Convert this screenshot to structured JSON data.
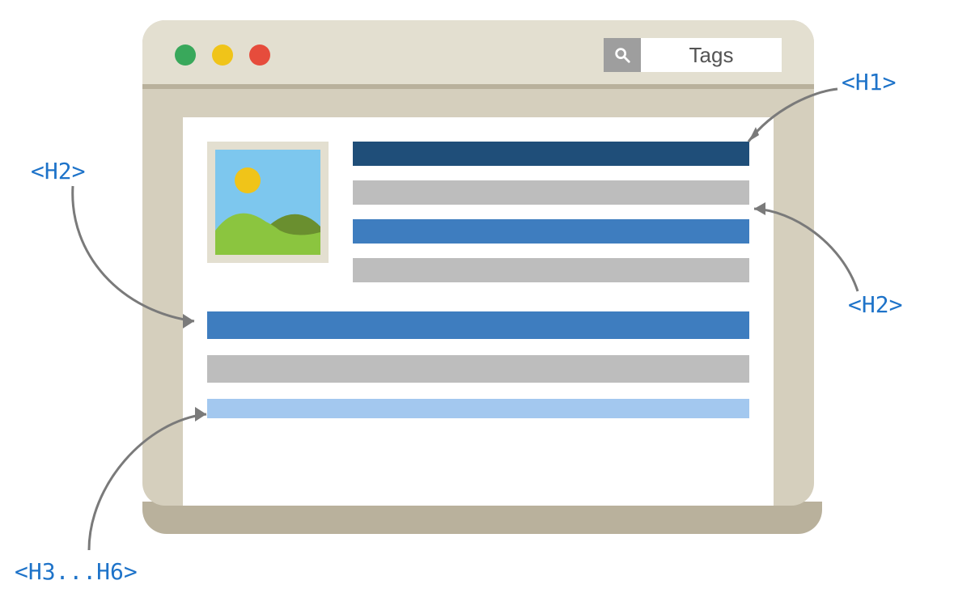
{
  "window": {
    "search_label": "Tags"
  },
  "annotations": {
    "h1": "<H1>",
    "h2a": "<H2>",
    "h2b": "<H2>",
    "h3to6": "<H3...H6>"
  },
  "colors": {
    "h1": "#1f4e79",
    "h2": "#3e7dbf",
    "h3": "#a3c8ef",
    "body_text": "#bdbdbd",
    "frame": "#d5cfbd",
    "frame_light": "#e3dfd0",
    "link": "#1e73c9"
  },
  "content_bars": {
    "right": [
      "h1",
      "text",
      "h2",
      "text"
    ],
    "bottom": [
      "h2",
      "text",
      "h3"
    ]
  }
}
